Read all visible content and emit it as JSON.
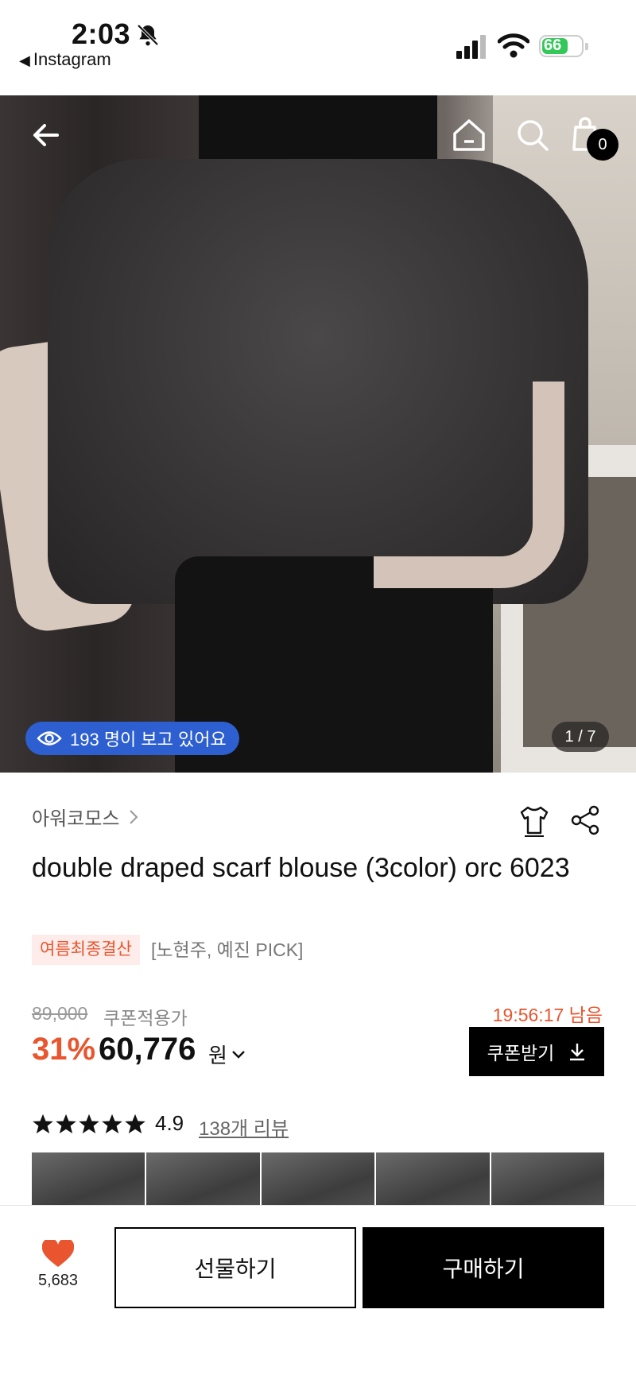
{
  "status_bar": {
    "time": "2:03",
    "back_app": "Instagram",
    "battery": "66"
  },
  "hero": {
    "viewers_text": "193 명이 보고 있어요",
    "image_counter": "1 / 7",
    "cart_count": "0"
  },
  "product": {
    "brand": "아워코모스",
    "title": "double draped scarf blouse (3color) orc 6023",
    "tag": "여름최종결산",
    "pick": "[노현주, 예진 PICK]",
    "original_price": "89,000",
    "coupon_price_label": "쿠폰적용가",
    "timer": "19:56:17 남음",
    "discount": "31%",
    "price": "60,776",
    "currency": "원",
    "coupon_button": "쿠폰받기",
    "rating": "4.9",
    "review_link": "138개 리뷰"
  },
  "bottom_bar": {
    "like_count": "5,683",
    "gift_button": "선물하기",
    "buy_button": "구매하기"
  },
  "colors": {
    "accent": "#e8552e",
    "viewers_badge": "#2d5fd0",
    "battery": "#34c759"
  },
  "icons": [
    "bell-slash-icon",
    "signal-icon",
    "wifi-icon",
    "battery-icon",
    "back-arrow-icon",
    "home-icon",
    "search-icon",
    "cart-icon",
    "eye-icon",
    "chevron-right-icon",
    "tshirt-size-icon",
    "share-icon",
    "chevron-down-icon",
    "download-icon",
    "star-icon",
    "heart-icon"
  ]
}
